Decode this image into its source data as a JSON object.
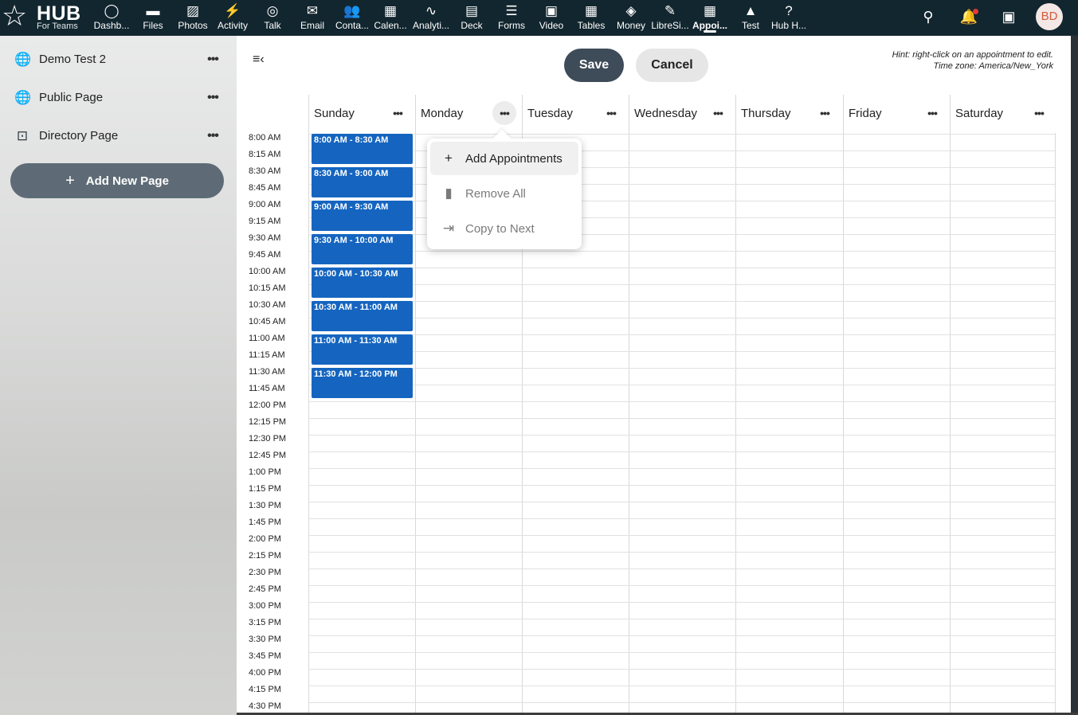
{
  "app": {
    "logo_text": "HUB",
    "logo_sub": "For Teams"
  },
  "nav": [
    {
      "label": "Dashb...",
      "icon": "dashboard-icon",
      "glyph": "◯"
    },
    {
      "label": "Files",
      "icon": "folder-icon",
      "glyph": "▬"
    },
    {
      "label": "Photos",
      "icon": "image-icon",
      "glyph": "▨"
    },
    {
      "label": "Activity",
      "icon": "lightning-icon",
      "glyph": "⚡"
    },
    {
      "label": "Talk",
      "icon": "search-bubble-icon",
      "glyph": "◎"
    },
    {
      "label": "Email",
      "icon": "mail-icon",
      "glyph": "✉"
    },
    {
      "label": "Conta...",
      "icon": "contacts-icon",
      "glyph": "👥"
    },
    {
      "label": "Calen...",
      "icon": "calendar-icon",
      "glyph": "▦"
    },
    {
      "label": "Analyti...",
      "icon": "analytics-icon",
      "glyph": "∿"
    },
    {
      "label": "Deck",
      "icon": "deck-icon",
      "glyph": "▤"
    },
    {
      "label": "Forms",
      "icon": "forms-icon",
      "glyph": "☰"
    },
    {
      "label": "Video",
      "icon": "video-icon",
      "glyph": "▣"
    },
    {
      "label": "Tables",
      "icon": "table-icon",
      "glyph": "▦"
    },
    {
      "label": "Money",
      "icon": "money-icon",
      "glyph": "◈"
    },
    {
      "label": "LibreSi...",
      "icon": "libresign-icon",
      "glyph": "✎"
    },
    {
      "label": "Appoi...",
      "icon": "appointments-icon",
      "glyph": "▦",
      "active": true
    },
    {
      "label": "Test",
      "icon": "rocket-icon",
      "glyph": "▲"
    },
    {
      "label": "Hub H...",
      "icon": "help-icon",
      "glyph": "?"
    }
  ],
  "topbar": {
    "avatar_initials": "BD"
  },
  "sidebar": {
    "items": [
      {
        "label": "Demo Test 2",
        "icon": "globe-icon"
      },
      {
        "label": "Public Page",
        "icon": "globe-off-icon"
      },
      {
        "label": "Directory Page",
        "icon": "directory-search-icon"
      }
    ],
    "add_button": "Add New Page"
  },
  "toolbar": {
    "save_label": "Save",
    "cancel_label": "Cancel",
    "hint_line1": "Hint: right-click on an appointment to edit.",
    "hint_line2": "Time zone: America/New_York"
  },
  "days": [
    "Sunday",
    "Monday",
    "Tuesday",
    "Wednesday",
    "Thursday",
    "Friday",
    "Saturday"
  ],
  "times": [
    "8:00 AM",
    "8:15 AM",
    "8:30 AM",
    "8:45 AM",
    "9:00 AM",
    "9:15 AM",
    "9:30 AM",
    "9:45 AM",
    "10:00 AM",
    "10:15 AM",
    "10:30 AM",
    "10:45 AM",
    "11:00 AM",
    "11:15 AM",
    "11:30 AM",
    "11:45 AM",
    "12:00 PM",
    "12:15 PM",
    "12:30 PM",
    "12:45 PM",
    "1:00 PM",
    "1:15 PM",
    "1:30 PM",
    "1:45 PM",
    "2:00 PM",
    "2:15 PM",
    "2:30 PM",
    "2:45 PM",
    "3:00 PM",
    "3:15 PM",
    "3:30 PM",
    "3:45 PM",
    "4:00 PM",
    "4:15 PM",
    "4:30 PM"
  ],
  "appointments": [
    "8:00 AM - 8:30 AM",
    "8:30 AM - 9:00 AM",
    "9:00 AM - 9:30 AM",
    "9:30 AM - 10:00 AM",
    "10:00 AM - 10:30 AM",
    "10:30 AM - 11:00 AM",
    "11:00 AM - 11:30 AM",
    "11:30 AM - 12:00 PM"
  ],
  "context_menu": {
    "items": [
      {
        "label": "Add Appointments",
        "icon": "plus-icon",
        "glyph": "+"
      },
      {
        "label": "Remove All",
        "icon": "trash-icon",
        "glyph": "🗑"
      },
      {
        "label": "Copy to Next",
        "icon": "copy-next-icon",
        "glyph": "⇥"
      }
    ]
  }
}
